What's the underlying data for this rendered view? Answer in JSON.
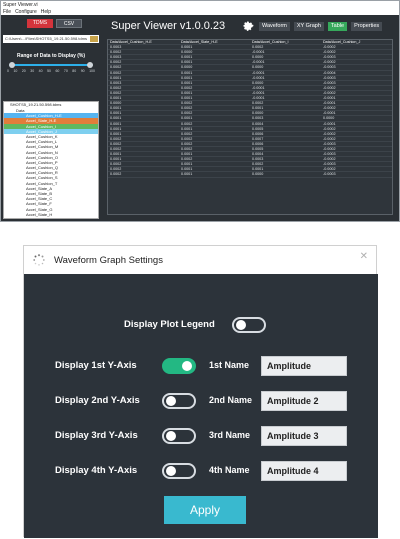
{
  "main_window": {
    "title": "Super Viewer.vi",
    "menu": [
      "File",
      "Configure",
      "Help"
    ],
    "format_tabs": [
      {
        "label": "TDMS",
        "active": true
      },
      {
        "label": "CSV",
        "active": false
      }
    ],
    "file_path": "C:\\Users\\...\\Files\\SHOTS5_19.21.50.598.tdms",
    "range_title": "Range of Data to Display (%)",
    "range_ticks": [
      "0",
      "10",
      "20",
      "30",
      "40",
      "50",
      "60",
      "70",
      "80",
      "90",
      "100"
    ],
    "range_low_pct": 0,
    "range_high_pct": 100,
    "tree": {
      "file": "SHOTS5_19.21.50.598.tdms",
      "group": "Data",
      "channels": [
        "Accel_Cushion_H-E",
        "Accel_Slate_H-E",
        "Accel_Cushion_I",
        "Accel_Cushion_J",
        "Accel_Cushion_K",
        "Accel_Cushion_L",
        "Accel_Cushion_M",
        "Accel_Cushion_N",
        "Accel_Cushion_O",
        "Accel_Cushion_P",
        "Accel_Cushion_Q",
        "Accel_Cushion_R",
        "Accel_Cushion_S",
        "Accel_Cushion_T",
        "Accel_Slate_A",
        "Accel_Slate_B",
        "Accel_Slate_C",
        "Accel_Slate_F",
        "Accel_Slate_G",
        "Accel_Slate_H",
        "Microphone_Foot",
        "Microphone_Head"
      ]
    },
    "app_title": "Super Viewer v1.0.0.23",
    "top_buttons": [
      {
        "label": "Waveform",
        "active": false
      },
      {
        "label": "XY Graph",
        "active": false
      },
      {
        "label": "Table",
        "active": true
      },
      {
        "label": "Properties",
        "active": false
      }
    ],
    "table": {
      "columns": [
        "Data/Accel_Cushion_H-E",
        "Data/Accel_Slate_H-E",
        "Data/Accel_Cushion_I",
        "Data/Accel_Cushion_J"
      ],
      "rows": [
        [
          "0.0003",
          "0.0001",
          "0.0002",
          "-0.0002"
        ],
        [
          "0.0002",
          "0.0000",
          "-0.0001",
          "-0.0002"
        ],
        [
          "0.0003",
          "0.0001",
          "0.0000",
          "-0.0003"
        ],
        [
          "0.0002",
          "0.0001",
          "-0.0001",
          "-0.0002"
        ],
        [
          "0.0002",
          "0.0000",
          "0.0000",
          "-0.0003"
        ],
        [
          "0.0002",
          "0.0001",
          "-0.0001",
          "-0.0004"
        ],
        [
          "0.0001",
          "0.0001",
          "-0.0001",
          "-0.0003"
        ],
        [
          "0.0003",
          "0.0001",
          "0.0000",
          "-0.0003"
        ],
        [
          "0.0002",
          "0.0002",
          "-0.0001",
          "-0.0002"
        ],
        [
          "0.0002",
          "0.0001",
          "-0.0001",
          "-0.0002"
        ],
        [
          "0.0001",
          "0.0001",
          "-0.0001",
          "-0.0001"
        ],
        [
          "0.0000",
          "0.0002",
          "0.0002",
          "-0.0001"
        ],
        [
          "0.0001",
          "0.0002",
          "0.0001",
          "-0.0002"
        ],
        [
          "0.0001",
          "0.0002",
          "0.0000",
          "-0.0001"
        ],
        [
          "0.0001",
          "0.0001",
          "0.0003",
          "0.0000"
        ],
        [
          "0.0001",
          "0.0002",
          "0.0004",
          "-0.0001"
        ],
        [
          "0.0001",
          "0.0001",
          "0.0005",
          "-0.0002"
        ],
        [
          "0.0001",
          "0.0002",
          "0.0006",
          "-0.0002"
        ],
        [
          "0.0002",
          "0.0002",
          "0.0007",
          "-0.0002"
        ],
        [
          "0.0002",
          "0.0002",
          "0.0006",
          "-0.0003"
        ],
        [
          "0.0002",
          "0.0002",
          "0.0005",
          "-0.0002"
        ],
        [
          "0.0001",
          "0.0001",
          "0.0004",
          "-0.0003"
        ],
        [
          "0.0001",
          "0.0002",
          "0.0003",
          "-0.0002"
        ],
        [
          "0.0002",
          "0.0001",
          "0.0002",
          "-0.0003"
        ],
        [
          "0.0002",
          "0.0001",
          "0.0001",
          "-0.0002"
        ],
        [
          "0.0002",
          "0.0001",
          "0.0000",
          "-0.0003"
        ]
      ]
    }
  },
  "dialog": {
    "title": "Waveform Graph Settings",
    "close_icon": "close-icon",
    "legend_label": "Display Plot Legend",
    "legend_on": false,
    "axes": [
      {
        "label": "Display 1st Y-Axis",
        "on": true,
        "name_label": "1st Name",
        "name_value": "Amplitude"
      },
      {
        "label": "Display 2nd Y-Axis",
        "on": false,
        "name_label": "2nd Name",
        "name_value": "Amplitude 2"
      },
      {
        "label": "Display 3rd Y-Axis",
        "on": false,
        "name_label": "3rd Name",
        "name_value": "Amplitude 3"
      },
      {
        "label": "Display 4th Y-Axis",
        "on": false,
        "name_label": "4th Name",
        "name_value": "Amplitude 4"
      }
    ],
    "apply_label": "Apply",
    "colors": {
      "accent_toggle": "#23b883",
      "apply": "#39b9cf",
      "tdms_tab": "#d4343c",
      "table_tab": "#36a85b"
    }
  }
}
